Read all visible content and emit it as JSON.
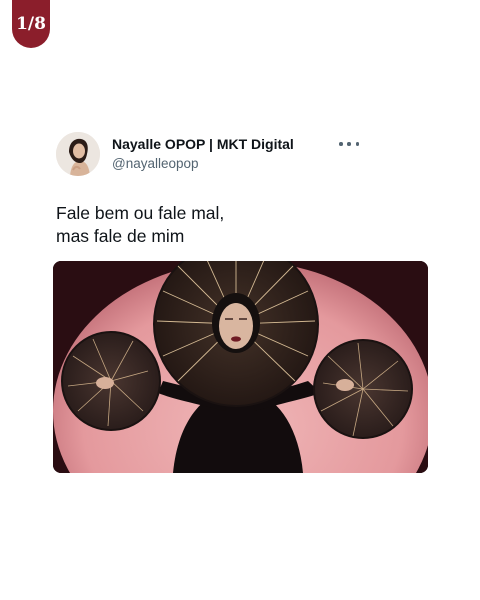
{
  "page_indicator": "1/8",
  "tweet": {
    "author": {
      "name": "Nayalle OPOP | MKT Digital",
      "handle": "@nayalleopop"
    },
    "text_lines": [
      "Fale bem ou fale mal,",
      "mas fale de mim"
    ],
    "menu_icon": "more-horizontal-icon"
  },
  "colors": {
    "badge": "#8b1e2b",
    "name_text": "#0f1419",
    "handle_text": "#536471",
    "photo_background": "#e6a3a6"
  }
}
